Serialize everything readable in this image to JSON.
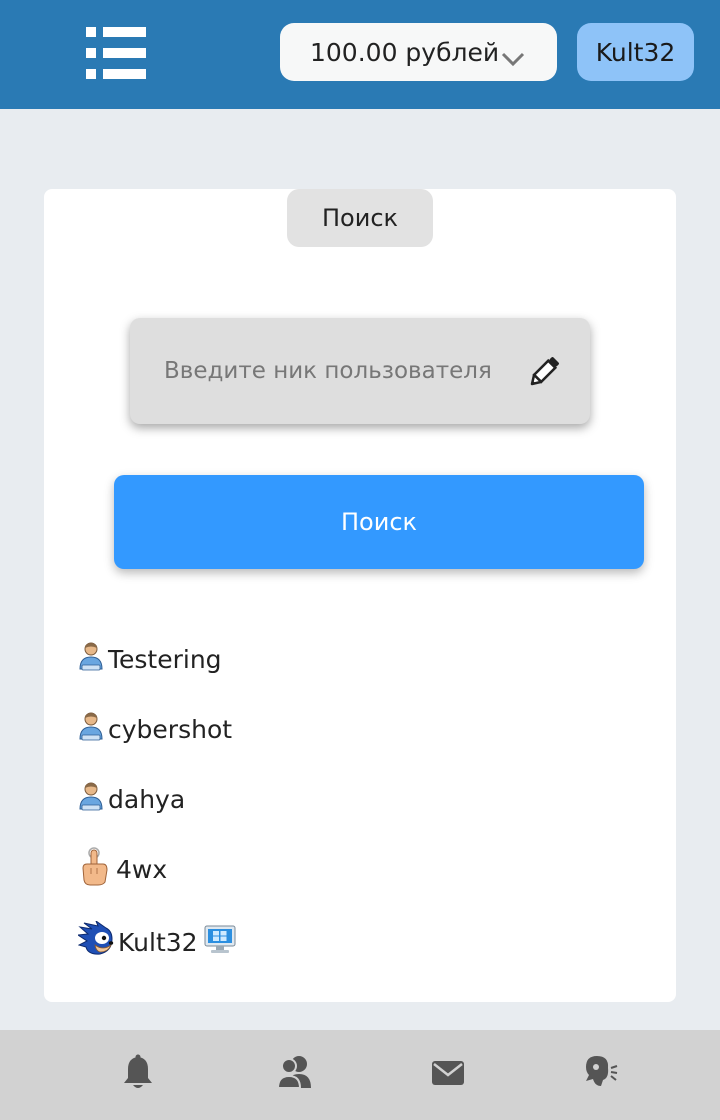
{
  "header": {
    "balance": "100.00 рублей",
    "username": "Kult32"
  },
  "card": {
    "tab_label": "Поиск",
    "search_placeholder": "Введите ник пользователя",
    "search_button": "Поиск"
  },
  "users": [
    {
      "name": "Testering",
      "icon": "user-avatar-icon"
    },
    {
      "name": "cybershot",
      "icon": "user-avatar-icon"
    },
    {
      "name": "dahya",
      "icon": "user-avatar-icon"
    },
    {
      "name": "4wx",
      "icon": "pointing-hand-icon"
    },
    {
      "name": "Kult32",
      "icon": "sonic-avatar-icon",
      "badge": "computer-icon"
    }
  ],
  "bottom_nav": [
    {
      "icon": "bell-icon"
    },
    {
      "icon": "friends-icon"
    },
    {
      "icon": "mail-icon"
    },
    {
      "icon": "chat-speak-icon"
    }
  ],
  "colors": {
    "header": "#2a7ab4",
    "user_button": "#8ec3f8",
    "search_button": "#3399ff",
    "background": "#e8ecf0",
    "bottom_bar": "#d2d2d2"
  }
}
